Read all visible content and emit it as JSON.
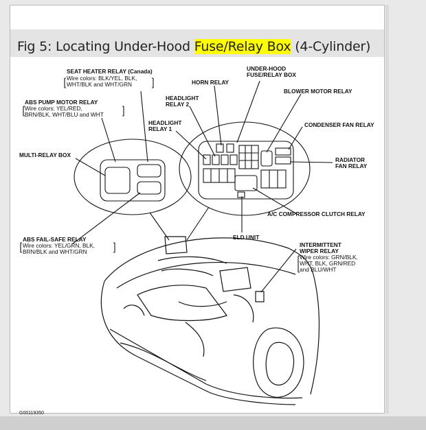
{
  "title": {
    "prefix": "Fig 5: Locating Under-Hood ",
    "highlight": "Fuse/Relay Box",
    "suffix": " (4-Cylinder)",
    "highlight_color": "#ffff00"
  },
  "labels": {
    "seat_heater": "SEAT HEATER RELAY (Canada)",
    "seat_heater_w1": "Wire colors: BLK/YEL, BLK,",
    "seat_heater_w2": "WHT/BLK and WHT/GRN",
    "abs_pump": "ABS PUMP MOTOR RELAY",
    "abs_pump_w1": "Wire colors: YEL/RED,",
    "abs_pump_w2": "BRN/BLK, WHT/BLU and WHT",
    "multi_relay": "MULTI-RELAY BOX",
    "abs_failsafe": "ABS FAIL-SAFE RELAY",
    "abs_failsafe_w1": "Wire colors: YEL/GRN, BLK,",
    "abs_failsafe_w2": "BRN/BLK and WHT/GRN",
    "horn": "HORN RELAY",
    "headlight2_a": "HEADLIGHT",
    "headlight2_b": "RELAY 2",
    "headlight1_a": "HEADLIGHT",
    "headlight1_b": "RELAY 1",
    "underhood_a": "UNDER-HOOD",
    "underhood_b": "FUSE/RELAY BOX",
    "blower": "BLOWER MOTOR RELAY",
    "condenser": "CONDENSER FAN RELAY",
    "radiator_a": "RADIATOR",
    "radiator_b": "FAN RELAY",
    "ac_clutch": "A/C COMPRESSOR CLUTCH RELAY",
    "eld": "ELD UNIT",
    "wiper_a": "INTERMITTENT",
    "wiper_b": "WIPER RELAY",
    "wiper_w1": "Wire colors: GRN/BLK,",
    "wiper_w2": "WHT, BLK, GRN/RED",
    "wiper_w3": "and BLU/WHT",
    "code": "G00119350"
  }
}
